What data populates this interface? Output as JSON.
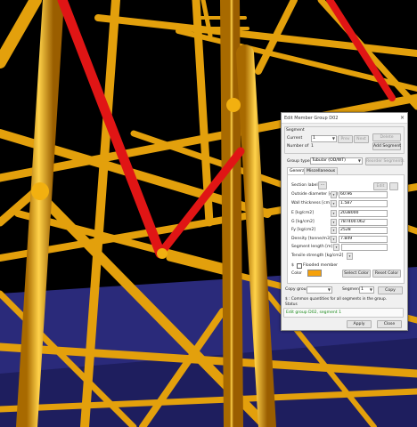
{
  "dialog": {
    "title": "Edit Member Group D02",
    "close_glyph": "×",
    "segment_group_label": "Segment",
    "current_label": "Current",
    "current_value": "1",
    "prev_label": "Prev",
    "next_label": "Next",
    "delete_label": "Delete",
    "number_of_label": "Number of",
    "number_of_value": "1",
    "add_segment_label": "Add Segment",
    "group_type_label": "Group type",
    "group_type_value": "Tubular (OD/WT)",
    "reorder_label": "Reorder Segments",
    "tabs": [
      "General",
      "Miscellaneous"
    ],
    "section_label": "Section label",
    "section_icon": "ellipsis-icon",
    "edit_label": "Edit",
    "fields": [
      {
        "label": "Outside diameter",
        "unit": "[cm]",
        "value": "60.96"
      },
      {
        "label": "Wall thickness",
        "unit": "[cm]",
        "value": "1.587"
      },
      {
        "label": "E",
        "unit": "[kg/cm2]",
        "value": "2038000"
      },
      {
        "label": "G",
        "unit": "[kg/cm2]",
        "value": "787400.062"
      },
      {
        "label": "Fy",
        "unit": "[kg/cm2]",
        "value": "2528"
      },
      {
        "label": "Density",
        "unit": "[tonne/m3]",
        "value": "7.849"
      },
      {
        "label": "Segment length",
        "unit": "[m]",
        "value": ""
      },
      {
        "label": "Tensile strength",
        "unit": "[kg/cm2]",
        "value": ""
      }
    ],
    "dollar_sign": "$",
    "flooded_label": "Flooded member",
    "color_label": "Color",
    "color_value": "#f5a10a",
    "select_color_label": "Select Color",
    "reset_color_label": "Reset Color",
    "copy_group_label": "Copy group",
    "segment_label": "Segment",
    "segment_value": "1",
    "copy_label": "Copy",
    "note_text": "$ : Common quantities for all segments in the group.",
    "status_label": "Status",
    "status_text": "Edit group D02, segment 1",
    "status_color": "#1a8a1a",
    "apply_label": "Apply",
    "close_label": "Close"
  },
  "scene_colors": {
    "background": "#000000",
    "tube": "#f2b010",
    "brace": "#e01515",
    "sea": "#2a2a7a"
  }
}
